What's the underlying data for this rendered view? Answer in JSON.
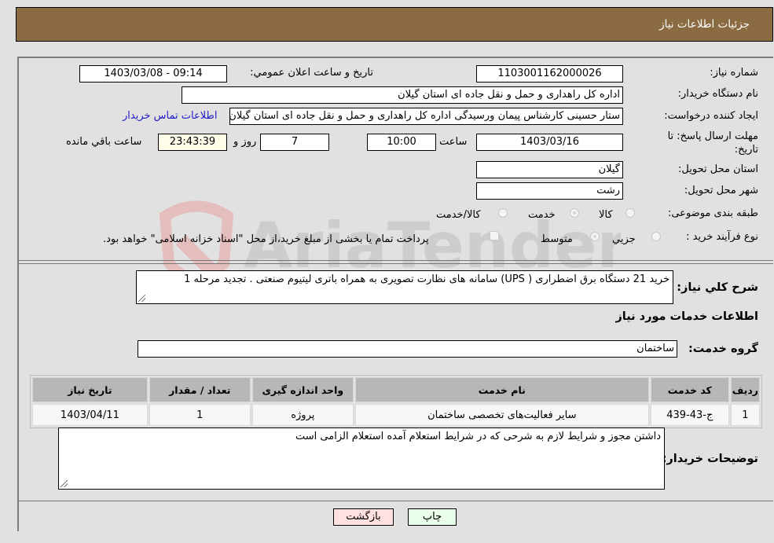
{
  "header": {
    "title": "جزئيات اطلاعات نیاز"
  },
  "fields": {
    "need_number": {
      "label": "شماره نیاز:",
      "value": "1103001162000026"
    },
    "announce_datetime": {
      "label": "تاریخ و ساعت اعلان عمومي:",
      "value": "1403/03/08 - 09:14"
    },
    "buyer_org": {
      "label": "نام دستگاه خریدار:",
      "value": "اداره کل راهداری و حمل و نقل جاده ای استان گیلان"
    },
    "requester": {
      "label": "ایجاد کننده درخواست:",
      "value": "ستار حسینی کارشناس پیمان ورسیدگی اداره کل راهداری و حمل و نقل جاده ای استان گیلان",
      "contact_link": "اطلاعات تماس خریدار"
    },
    "deadline": {
      "label": "مهلت ارسال پاسخ: تا تاریخ:",
      "date": "1403/03/16",
      "time_label": "ساعت",
      "time": "10:00",
      "days": "7",
      "days_label": "روز و",
      "remaining": "23:43:39",
      "remaining_label": "ساعت باقي مانده"
    },
    "province": {
      "label": "استان محل تحویل:",
      "value": "گیلان"
    },
    "city": {
      "label": "شهر محل تحویل:",
      "value": "رشت"
    },
    "category": {
      "label": "طبقه بندی موضوعی:",
      "options": [
        "کالا",
        "خدمت",
        "کالا/خدمت"
      ],
      "selected": "خدمت"
    },
    "purchase_process": {
      "label": "نوع فرآیند خرید :",
      "options": [
        "جزيي",
        "متوسط"
      ],
      "selected": "متوسط",
      "treasury_note": "پرداخت تمام یا بخشی از مبلغ خرید،از محل \"اسناد خزانه اسلامی\" خواهد بود."
    }
  },
  "description": {
    "label": "شرح کلي نیاز:",
    "value": "خرید  21 دستگاه برق اضطراری ( UPS) سامانه های نظارت تصویری به همراه باتری لیتیوم صنعتی . تجدید مرحله 1"
  },
  "services_section": {
    "title": "اطلاعات خدمات مورد نیاز",
    "group_label": "گروه خدمت:",
    "group_value": "ساختمان",
    "table": {
      "headers": [
        "ردیف",
        "کد خدمت",
        "نام خدمت",
        "واحد اندازه گیری",
        "تعداد / مقدار",
        "تاریخ نیاز"
      ],
      "rows": [
        [
          "1",
          "ج-43-439",
          "سایر فعالیت‌های تخصصی ساختمان",
          "پروژه",
          "1",
          "1403/04/11"
        ]
      ]
    }
  },
  "buyer_notes": {
    "label": "توضیحات خریدار:",
    "value": "داشتن مجوز و شرایط لازم به شرحی که در شرایط استعلام آمده استعلام الزامی است"
  },
  "buttons": {
    "print": "چاپ",
    "back": "بازگشت"
  },
  "colors": {
    "header_bg": "#8b6c42",
    "print_bg": "#eaffea",
    "back_bg": "#ffe1e1",
    "link": "#1c1ccc"
  },
  "watermark": "AriaTender.neT"
}
